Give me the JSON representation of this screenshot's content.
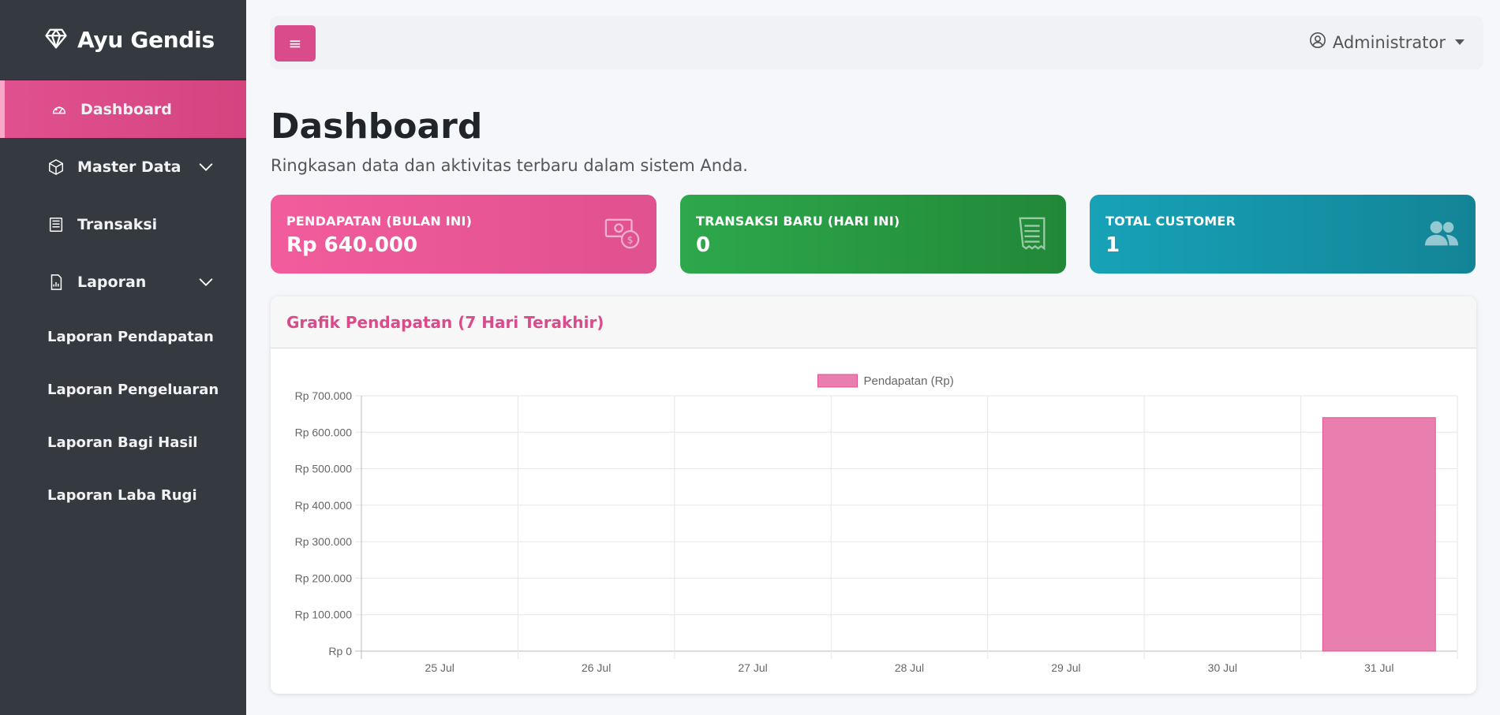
{
  "app": {
    "brand": "Ayu Gendis",
    "brand_icon": "diamond-icon"
  },
  "sidebar": {
    "items": [
      {
        "label": "Dashboard",
        "icon": "speedometer-icon",
        "active": true
      },
      {
        "label": "Master Data",
        "icon": "box-icon",
        "expandable": true
      },
      {
        "label": "Transaksi",
        "icon": "receipt-icon"
      },
      {
        "label": "Laporan",
        "icon": "report-chart-icon",
        "expandable": true
      }
    ],
    "subitems": [
      {
        "label": "Laporan Pendapatan"
      },
      {
        "label": "Laporan Pengeluaran"
      },
      {
        "label": "Laporan Bagi Hasil"
      },
      {
        "label": "Laporan Laba Rugi"
      }
    ]
  },
  "topbar": {
    "toggle_icon": "≡",
    "user_label": "Administrator"
  },
  "page": {
    "title": "Dashboard",
    "subtitle": "Ringkasan data dan aktivitas terbaru dalam sistem Anda."
  },
  "stats": [
    {
      "label": "PENDAPATAN (BULAN INI)",
      "value": "Rp 640.000",
      "icon": "cash-coin-icon",
      "color": "#e0518f"
    },
    {
      "label": "TRANSAKSI BARU (HARI INI)",
      "value": "0",
      "icon": "receipt-icon",
      "color": "#28a745"
    },
    {
      "label": "TOTAL CUSTOMER",
      "value": "1",
      "icon": "people-icon",
      "color": "#17a2b8"
    }
  ],
  "chart_card": {
    "title": "Grafik Pendapatan (7 Hari Terakhir)"
  },
  "chart_data": {
    "type": "bar",
    "categories": [
      "25 Jul",
      "26 Jul",
      "27 Jul",
      "28 Jul",
      "29 Jul",
      "30 Jul",
      "31 Jul"
    ],
    "series": [
      {
        "name": "Pendapatan (Rp)",
        "values": [
          0,
          0,
          0,
          0,
          0,
          0,
          640000
        ]
      }
    ],
    "y_ticks": [
      "Rp 0",
      "Rp 100.000",
      "Rp 200.000",
      "Rp 300.000",
      "Rp 400.000",
      "Rp 500.000",
      "Rp 600.000",
      "Rp 700.000"
    ],
    "ylim": [
      0,
      700000
    ],
    "grid": true,
    "legend_position": "top",
    "bar_color": "#e87fae"
  }
}
